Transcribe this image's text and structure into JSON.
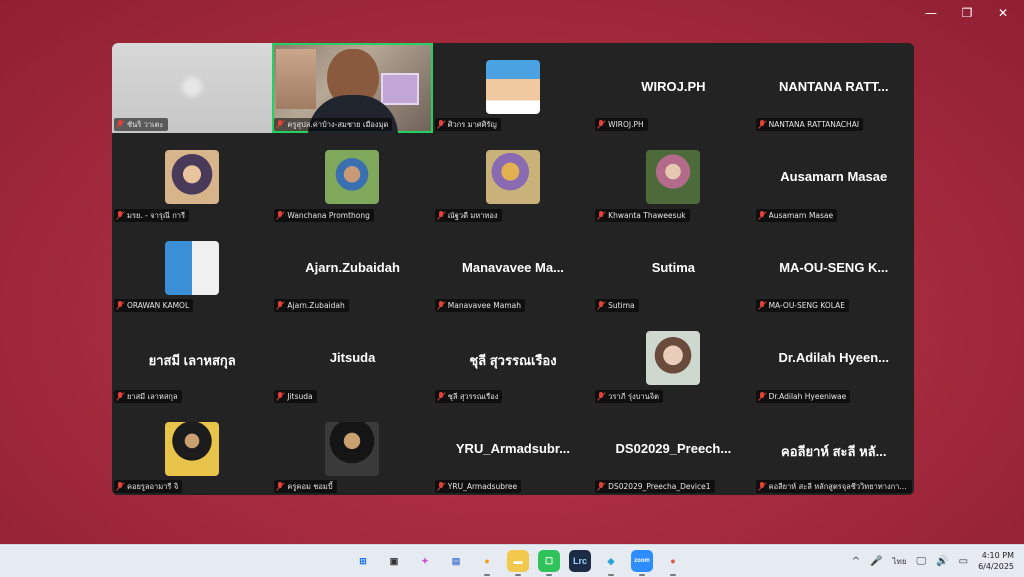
{
  "window_controls": {
    "minimize": "—",
    "restore": "❐",
    "close": "✕"
  },
  "colors": {
    "active_border": "#23d160",
    "mic_muted": "#e2413b",
    "tile_bg": "#232323"
  },
  "participants": [
    {
      "label": "ชันริ วาเตะ",
      "display": "",
      "type": "blur"
    },
    {
      "label": "ครูสุปล.ค่าบ้าง-สมชาย เมืองมุด",
      "display": "",
      "type": "video",
      "active": true
    },
    {
      "label": "ศิวกร มาศศิรัญ",
      "display": "",
      "type": "avatar",
      "avatar_style": "cartoon"
    },
    {
      "label": "WIROJ.PH",
      "display": "WIROJ.PH",
      "type": "name"
    },
    {
      "label": "NANTANA RATTANACHAI",
      "display": "NANTANA RATT...",
      "type": "name"
    },
    {
      "label": "มรย. - จารุณี การี",
      "display": "",
      "type": "avatar",
      "avatar_style": "hijab"
    },
    {
      "label": "Wanchana Promthong",
      "display": "",
      "type": "avatar",
      "avatar_style": "outdoor"
    },
    {
      "label": "ณัฐวดี มหาทอง",
      "display": "",
      "type": "avatar",
      "avatar_style": "yellow"
    },
    {
      "label": "Khwanta Thaweesuk",
      "display": "",
      "type": "avatar",
      "avatar_style": "forest"
    },
    {
      "label": "Ausamarn Masae",
      "display": "Ausamarn Masae",
      "type": "name"
    },
    {
      "label": "ORAWAN KAMOL",
      "display": "",
      "type": "avatar",
      "avatar_style": "collage"
    },
    {
      "label": "Ajarn.Zubaidah",
      "display": "Ajarn.Zubaidah",
      "type": "name"
    },
    {
      "label": "Manavavee Mamah",
      "display": "Manavavee Ma...",
      "type": "name"
    },
    {
      "label": "Sutima",
      "display": "Sutima",
      "type": "name"
    },
    {
      "label": "MA-OU-SENG KOLAE",
      "display": "MA-OU-SENG K...",
      "type": "name"
    },
    {
      "label": "ยาสมี เลาหสกุล",
      "display": "ยาสมี เลาหสกุล",
      "type": "name"
    },
    {
      "label": "Jitsuda",
      "display": "Jitsuda",
      "type": "name"
    },
    {
      "label": "ชุลี สุวรรณเรือง",
      "display": "ชุลี สุวรรณเรือง",
      "type": "name"
    },
    {
      "label": "วราภี รุ่งบานจิต",
      "display": "",
      "type": "avatar",
      "avatar_style": "portrait"
    },
    {
      "label": "Dr.Adilah Hyeeniwae",
      "display": "Dr.Adilah Hyeen...",
      "type": "name"
    },
    {
      "label": "คอยรูลอามารี จิ",
      "display": "",
      "type": "avatar",
      "avatar_style": "suit-gold"
    },
    {
      "label": "ครูคอม ชอมบี้",
      "display": "",
      "type": "avatar",
      "avatar_style": "suit-dark"
    },
    {
      "label": "YRU_Armadsubree",
      "display": "YRU_Armadsubr...",
      "type": "name"
    },
    {
      "label": "DS02029_Preecha_Device1",
      "display": "DS02029_Preech...",
      "type": "name"
    },
    {
      "label": "คอลียาห์ สะลี หลักสูตรจุลชีววิทยาทางการแพทย์",
      "display": "คอลียาห์ สะลี หลั...",
      "type": "name"
    }
  ],
  "taskbar": {
    "apps": [
      {
        "name": "start-icon",
        "glyph": "⊞",
        "bg": "#e6eaf1",
        "fg": "#1a73e8"
      },
      {
        "name": "task-view-icon",
        "glyph": "▣",
        "bg": "#e6eaf1",
        "fg": "#333333"
      },
      {
        "name": "copilot-icon",
        "glyph": "✦",
        "bg": "#e6eaf1",
        "fg": "#c94fd1"
      },
      {
        "name": "chat-icon",
        "glyph": "▤",
        "bg": "#e6eaf1",
        "fg": "#4a7ad8"
      },
      {
        "name": "chrome-icon",
        "glyph": "●",
        "bg": "#e6eaf1",
        "fg": "#e8a317"
      },
      {
        "name": "file-explorer-icon",
        "glyph": "▬",
        "bg": "#f2c94c",
        "fg": "#ffffff"
      },
      {
        "name": "line-icon",
        "glyph": "☐",
        "bg": "#2fc35a",
        "fg": "#ffffff"
      },
      {
        "name": "lightroom-icon",
        "glyph": "Lrc",
        "bg": "#1b2c44",
        "fg": "#9ccfff"
      },
      {
        "name": "edge-icon",
        "glyph": "◆",
        "bg": "#e6eaf1",
        "fg": "#2aa3d6"
      },
      {
        "name": "zoom-icon",
        "glyph": "zoom",
        "bg": "#2d8cff",
        "fg": "#ffffff"
      },
      {
        "name": "chrome-profile-icon",
        "glyph": "●",
        "bg": "#e6eaf1",
        "fg": "#d95a4a"
      }
    ],
    "tray": {
      "chevron": "^",
      "mic": "🎤",
      "language": "ไทย",
      "time": "4:10 PM",
      "date": "6/4/2025"
    }
  }
}
